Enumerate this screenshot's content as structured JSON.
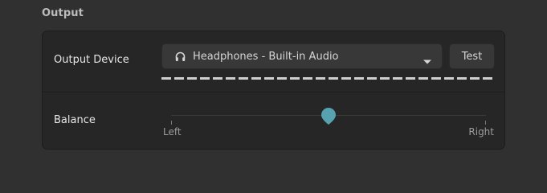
{
  "section": {
    "title": "Output"
  },
  "output_device": {
    "label": "Output Device",
    "selected": "Headphones - Built-in Audio",
    "device_icon": "headphones-icon",
    "test_label": "Test"
  },
  "balance": {
    "label": "Balance",
    "left_label": "Left",
    "right_label": "Right",
    "value": 0.5
  },
  "colors": {
    "accent": "#57a2b0",
    "background": "#303030",
    "card": "#262626"
  }
}
